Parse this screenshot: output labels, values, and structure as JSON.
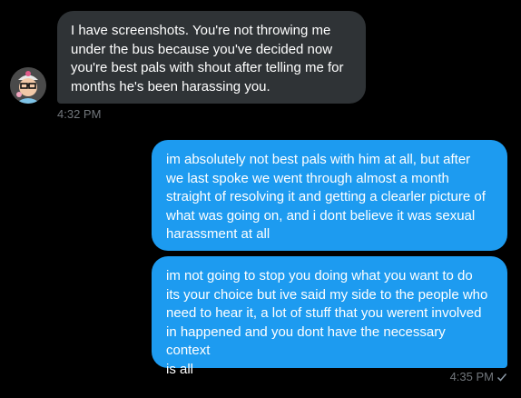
{
  "conversation": {
    "incoming": {
      "text": "I have screenshots. You're not throwing me\nunder the bus because you've decided now\nyou're best pals with shout after telling me for\nmonths he's been harassing you.",
      "time": "4:32 PM"
    },
    "outgoing": [
      {
        "text": "im absolutely not best pals with him at all, but after\nwe last spoke we went through almost a month\nstraight of resolving it and getting a clearler picture of\nwhat was going on, and i dont believe it was sexual\nharassment at all"
      },
      {
        "text": "im not going to stop you doing what you want to do\nits your choice but ive said my side to the people who\nneed to hear it, a lot of stuff that you werent involved\nin happened and you dont have the necessary context\nis all"
      }
    ],
    "outgoing_time": "4:35 PM"
  },
  "icons": {
    "avatar": "cartoon-avatar-icon",
    "status": "checkmark-icon"
  },
  "colors": {
    "background": "#000000",
    "incoming_bubble": "#2f3336",
    "outgoing_bubble": "#1d9bf0",
    "timestamp": "#71767b"
  }
}
